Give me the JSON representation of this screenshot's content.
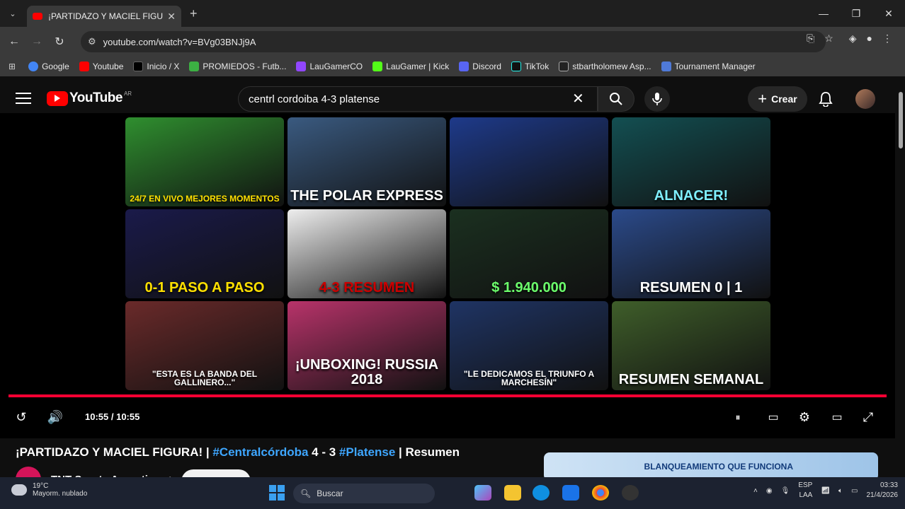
{
  "browser": {
    "tab_title": "¡PARTIDAZO Y MACIEL FIGURA!",
    "tab_close": "✕",
    "new_tab": "+",
    "url": "youtube.com/watch?v=BVg03BNJj9A",
    "bookmarks": [
      "Google",
      "Youtube",
      "Inicio / X",
      "PROMIEDOS - Futb...",
      "LauGamerCO",
      "LauGamer | Kick",
      "Discord",
      "TikTok",
      "stbartholomew Asp...",
      "Tournament Manager"
    ],
    "bookmark_colors": [
      "#4285f4",
      "#ff0000",
      "#111111",
      "#3cb043",
      "#9146ff",
      "#53fc18",
      "#5865f2",
      "#111111",
      "#222222",
      "#4f7ad8"
    ]
  },
  "youtube": {
    "logo_text": "YouTube",
    "region": "AR",
    "search_query": "centrl cordoiba 4-3 platense",
    "create_label": "Crear"
  },
  "endscreen": [
    {
      "caption": "24/7 EN VIVO MEJORES MOMENTOS",
      "bg": "#2f8f2f",
      "color": "#ffe000"
    },
    {
      "caption": "THE POLAR EXPRESS",
      "bg": "#3a5a80",
      "color": "#ffffff"
    },
    {
      "caption": "",
      "bg": "#1e3a8a",
      "color": "#ffffff"
    },
    {
      "caption": "ALNACER!",
      "bg": "#134f52",
      "color": "#7ff0ff"
    },
    {
      "caption": "0-1 PASO A PASO",
      "bg": "#1a1a4a",
      "color": "#ffe000"
    },
    {
      "caption": "4-3 RESUMEN",
      "bg": "#eeeeee",
      "color": "#cc0000"
    },
    {
      "caption": "$ 1.940.000",
      "bg": "#1b3020",
      "color": "#6cff6c"
    },
    {
      "caption": "RESUMEN 0 | 1",
      "bg": "#2b4a8a",
      "color": "#ffffff"
    },
    {
      "caption": "\"ESTA ES LA BANDA DEL GALLINERO...\"",
      "bg": "#6a2a2a",
      "color": "#ffffff"
    },
    {
      "caption": "¡UNBOXING! RUSSIA 2018",
      "bg": "#b8336a",
      "color": "#ffffff"
    },
    {
      "caption": "\"LE DEDICAMOS EL TRIUNFO A MARCHESÍN\"",
      "bg": "#1f3464",
      "color": "#ffffff"
    },
    {
      "caption": "RESUMEN SEMANAL",
      "bg": "#3f5e2a",
      "color": "#ffffff"
    }
  ],
  "player": {
    "time": "10:55 / 10:55"
  },
  "video": {
    "title_part1": "¡PARTIDAZO Y MACIEL FIGURA! | ",
    "hashtag1": "#Centralcórdoba",
    "title_part2": " 4 - 3 ",
    "hashtag2": "#Platense",
    "title_part3": " | Resumen",
    "channel": "TNT Sports Argentina",
    "ad_text": "BLANQUEAMIENTO QUE FUNCIONA"
  },
  "taskbar": {
    "temp": "19°C",
    "weather": "Mayorm. nublado",
    "search_label": "Buscar",
    "lang1": "ESP",
    "lang2": "LAA",
    "time": "03:33",
    "date": "21/4/2026"
  }
}
